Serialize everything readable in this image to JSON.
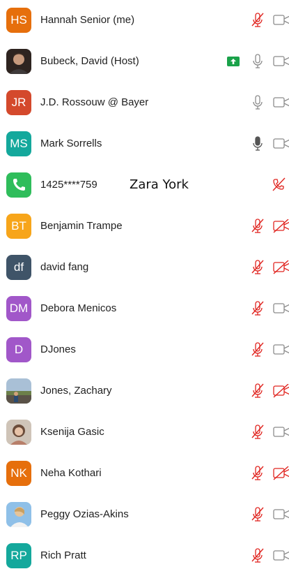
{
  "participants": [
    {
      "initials": "HS",
      "name": "Hannah Senior (me)",
      "avatar_type": "initials",
      "avatar_color": "#e66f0c",
      "mic": "muted",
      "video": "on"
    },
    {
      "initials": "",
      "name": "Bubeck, David (Host)",
      "avatar_type": "photo",
      "avatar_color": "#3a2a22",
      "sharing": true,
      "mic": "on",
      "video": "on"
    },
    {
      "initials": "JR",
      "name": "J.D. Rossouw @ Bayer",
      "avatar_type": "initials",
      "avatar_color": "#d4492c",
      "mic": "on",
      "video": "on"
    },
    {
      "initials": "MS",
      "name": "Mark Sorrells",
      "avatar_type": "initials",
      "avatar_color": "#14a89c",
      "mic": "speaking",
      "video": "on"
    },
    {
      "initials": "",
      "name": "1425****759",
      "alias": "Zara York",
      "avatar_type": "phone",
      "avatar_color": "#2fbd5b",
      "mic": "phone-muted",
      "video": "none"
    },
    {
      "initials": "BT",
      "name": "Benjamin Trampe",
      "avatar_type": "initials",
      "avatar_color": "#f7a51a",
      "mic": "muted",
      "video": "off"
    },
    {
      "initials": "df",
      "name": "david fang",
      "avatar_type": "initials",
      "avatar_color": "#3f5468",
      "mic": "muted",
      "video": "off"
    },
    {
      "initials": "DM",
      "name": "Debora Menicos",
      "avatar_type": "initials",
      "avatar_color": "#a157c9",
      "mic": "muted",
      "video": "on"
    },
    {
      "initials": "D",
      "name": "DJones",
      "avatar_type": "initials",
      "avatar_color": "#a157c9",
      "mic": "muted",
      "video": "on"
    },
    {
      "initials": "",
      "name": "Jones, Zachary",
      "avatar_type": "photo",
      "avatar_color": "#7a8fa3",
      "mic": "muted",
      "video": "off"
    },
    {
      "initials": "",
      "name": "Ksenija Gasic",
      "avatar_type": "photo",
      "avatar_color": "#9a7d6c",
      "mic": "muted",
      "video": "on"
    },
    {
      "initials": "NK",
      "name": "Neha Kothari",
      "avatar_type": "initials",
      "avatar_color": "#e66f0c",
      "mic": "muted",
      "video": "off"
    },
    {
      "initials": "",
      "name": "Peggy Ozias-Akins",
      "avatar_type": "photo",
      "avatar_color": "#7aa7cf",
      "mic": "muted",
      "video": "on"
    },
    {
      "initials": "RP",
      "name": "Rich Pratt",
      "avatar_type": "initials",
      "avatar_color": "#14a89c",
      "mic": "muted",
      "video": "on"
    }
  ]
}
